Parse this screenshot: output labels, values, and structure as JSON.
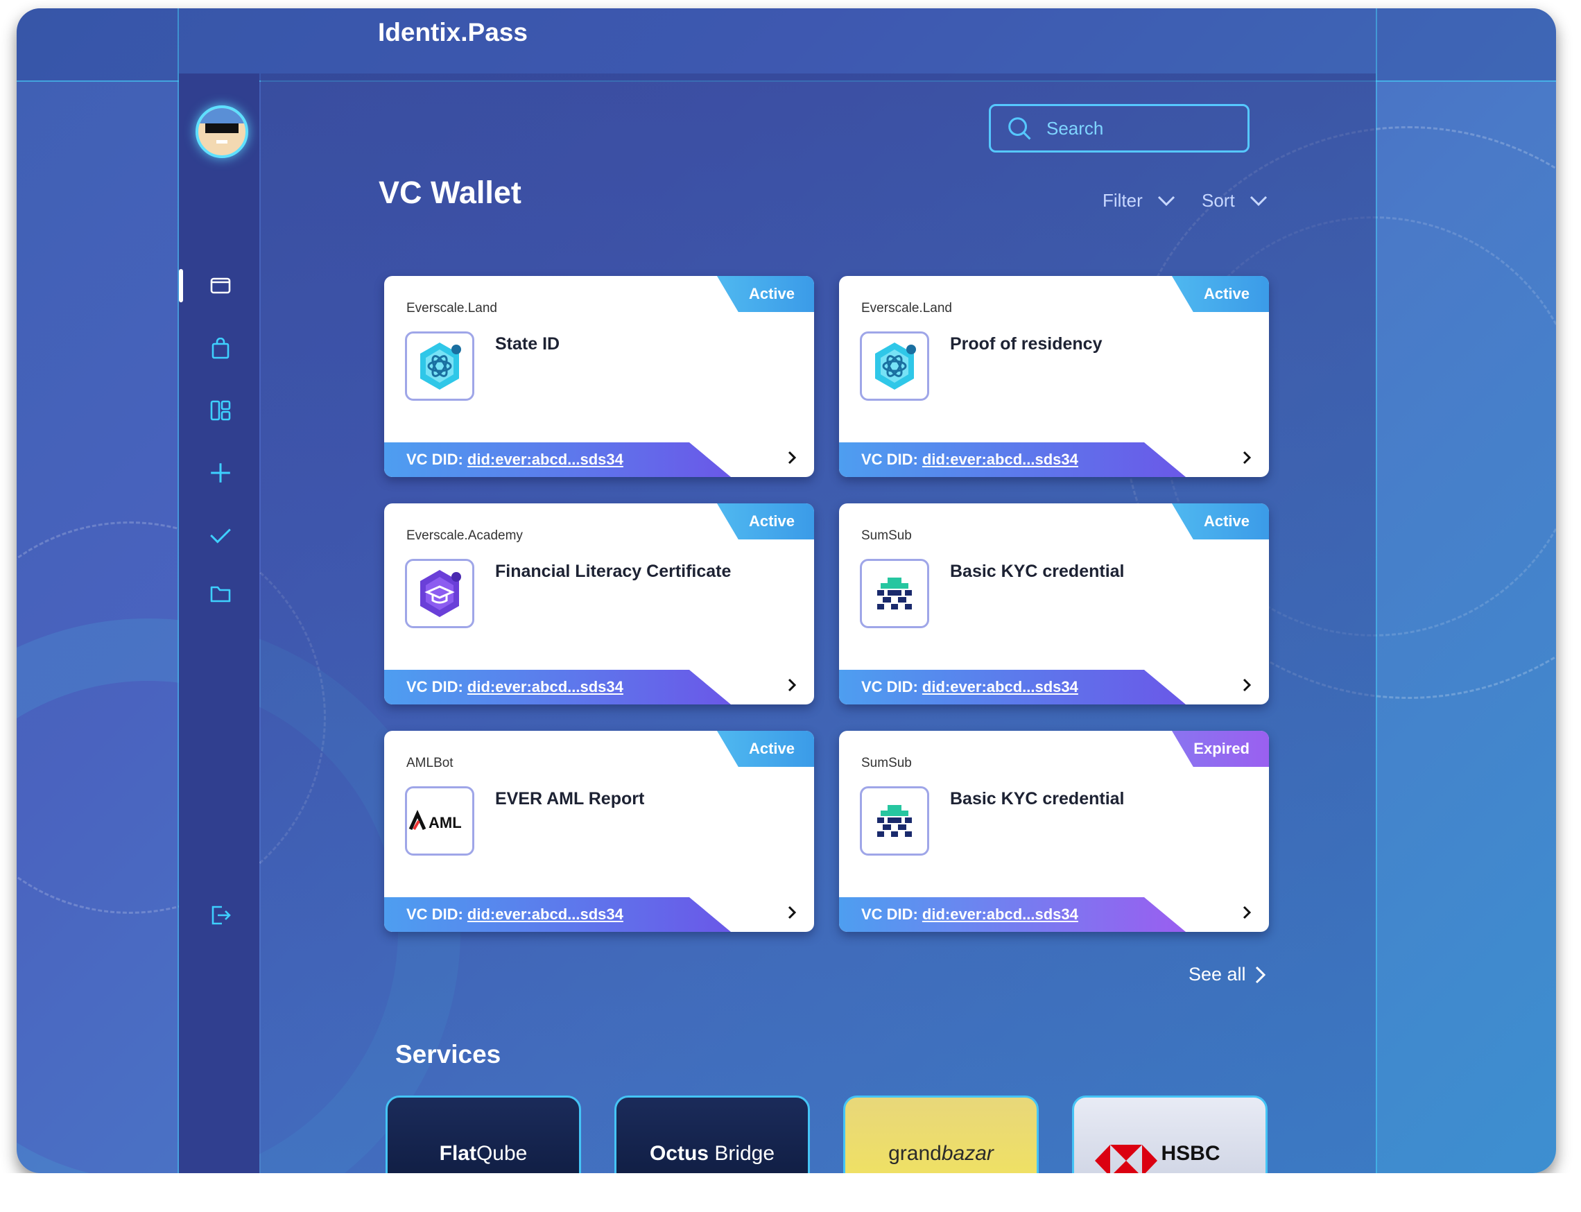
{
  "app": {
    "title": "Identix.Pass"
  },
  "search": {
    "placeholder": "Search"
  },
  "page": {
    "title": "VC Wallet"
  },
  "filters": {
    "filter_label": "Filter",
    "sort_label": "Sort"
  },
  "sidebar": {
    "items": [
      {
        "name": "wallet",
        "icon": "wallet-icon"
      },
      {
        "name": "shop",
        "icon": "shopping-bag-icon"
      },
      {
        "name": "dashboard",
        "icon": "dashboard-icon"
      },
      {
        "name": "add",
        "icon": "plus-icon"
      },
      {
        "name": "verify",
        "icon": "check-icon"
      },
      {
        "name": "folder",
        "icon": "folder-icon"
      }
    ],
    "logout_icon": "logout-icon"
  },
  "cards": [
    {
      "issuer": "Everscale.Land",
      "title": "State ID",
      "status": "Active",
      "did_label": "VC DID:",
      "did_value": "did:ever:abcd...sds34",
      "logo": "atom-badge-icon"
    },
    {
      "issuer": "Everscale.Land",
      "title": "Proof of residency",
      "status": "Active",
      "did_label": "VC DID:",
      "did_value": "did:ever:abcd...sds34",
      "logo": "atom-badge-icon"
    },
    {
      "issuer": "Everscale.Academy",
      "title": "Financial Literacy Certificate",
      "status": "Active",
      "did_label": "VC DID:",
      "did_value": "did:ever:abcd...sds34",
      "logo": "graduation-badge-icon"
    },
    {
      "issuer": "SumSub",
      "title": "Basic KYC credential",
      "status": "Active",
      "did_label": "VC DID:",
      "did_value": "did:ever:abcd...sds34",
      "logo": "sumsub-logo"
    },
    {
      "issuer": "AMLBot",
      "title": "EVER AML Report",
      "status": "Active",
      "did_label": "VC DID:",
      "did_value": "did:ever:abcd...sds34",
      "logo": "aml-logo",
      "logo_text": "AML"
    },
    {
      "issuer": "SumSub",
      "title": "Basic KYC credential",
      "status": "Expired",
      "did_label": "VC DID:",
      "did_value": "did:ever:abcd...sds34",
      "logo": "sumsub-logo"
    }
  ],
  "see_all": "See all",
  "services": {
    "title": "Services",
    "items": [
      {
        "name_bold": "Flat",
        "name_rest": "Qube"
      },
      {
        "name_bold": "Octus",
        "name_rest": " Bridge"
      },
      {
        "name_bold": "grand",
        "name_rest": "bazar"
      },
      {
        "name_bold": "HSBC",
        "name_rest": ""
      }
    ]
  },
  "colors": {
    "accent": "#56c8ff",
    "active_tab": "#3b9be8",
    "expired_tab": "#9a60f0",
    "sidebar": "#303f8f"
  }
}
